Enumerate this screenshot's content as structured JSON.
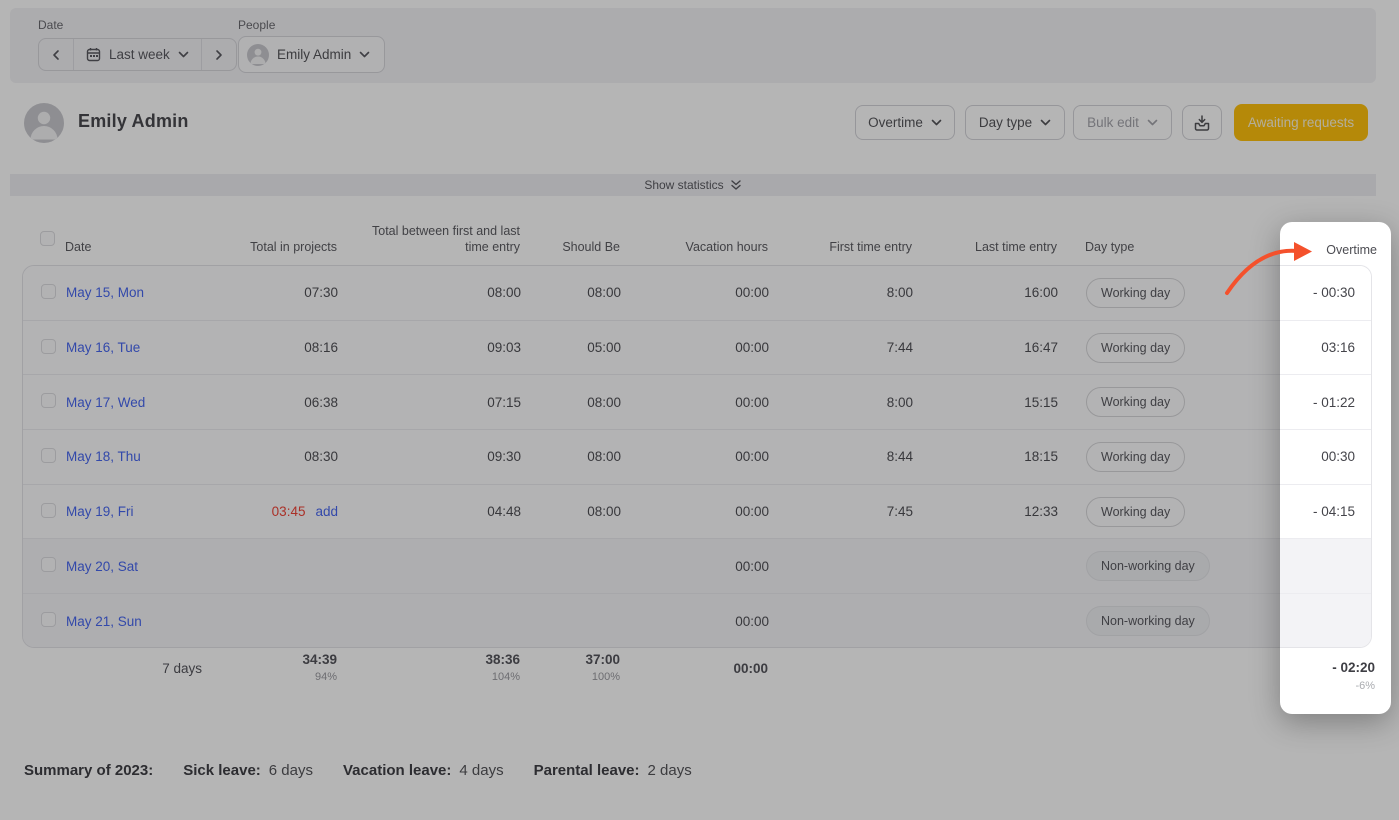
{
  "filters": {
    "date_label": "Date",
    "date_range": "Last week",
    "people_label": "People",
    "person": "Emily Admin"
  },
  "header": {
    "user_name": "Emily Admin",
    "overtime_button": "Overtime",
    "day_type_button": "Day type",
    "bulk_edit_button": "Bulk edit",
    "awaiting_button": "Awaiting requests"
  },
  "statistics_toggle": "Show statistics",
  "table": {
    "columns": [
      "Date",
      "Total in projects",
      "Total between first and last time entry",
      "Should Be",
      "Vacation hours",
      "First time entry",
      "Last time entry",
      "Day type",
      "Overtime"
    ],
    "rows": [
      {
        "date": "May 15, Mon",
        "total_projects": "07:30",
        "total_between": "08:00",
        "should_be": "08:00",
        "vacation": "00:00",
        "first": "8:00",
        "last": "16:00",
        "day_type": "Working day",
        "overtime": "- 00:30"
      },
      {
        "date": "May 16, Tue",
        "total_projects": "08:16",
        "total_between": "09:03",
        "should_be": "05:00",
        "vacation": "00:00",
        "first": "7:44",
        "last": "16:47",
        "day_type": "Working day",
        "overtime": "03:16"
      },
      {
        "date": "May 17, Wed",
        "total_projects": "06:38",
        "total_between": "07:15",
        "should_be": "08:00",
        "vacation": "00:00",
        "first": "8:00",
        "last": "15:15",
        "day_type": "Working day",
        "overtime": "- 01:22"
      },
      {
        "date": "May 18, Thu",
        "total_projects": "08:30",
        "total_between": "09:30",
        "should_be": "08:00",
        "vacation": "00:00",
        "first": "8:44",
        "last": "18:15",
        "day_type": "Working day",
        "overtime": "00:30"
      },
      {
        "date": "May 19, Fri",
        "total_projects": "03:45",
        "add_link": "add",
        "total_between": "04:48",
        "should_be": "08:00",
        "vacation": "00:00",
        "first": "7:45",
        "last": "12:33",
        "day_type": "Working day",
        "overtime": "- 04:15"
      },
      {
        "date": "May 20, Sat",
        "vacation": "00:00",
        "day_type": "Non-working day",
        "overtime": ""
      },
      {
        "date": "May 21, Sun",
        "vacation": "00:00",
        "day_type": "Non-working day",
        "overtime": ""
      }
    ],
    "summary": {
      "days": "7 days",
      "total_projects": "34:39",
      "total_projects_pct": "94%",
      "total_between": "38:36",
      "total_between_pct": "104%",
      "should_be": "37:00",
      "should_be_pct": "100%",
      "vacation": "00:00",
      "overtime_total": "- 02:20",
      "overtime_pct": "-6%"
    }
  },
  "year_summary": {
    "title": "Summary of 2023:",
    "items": [
      {
        "label": "Sick leave:",
        "value": "6 days"
      },
      {
        "label": "Vacation leave:",
        "value": "4 days"
      },
      {
        "label": "Parental leave:",
        "value": "2 days"
      }
    ]
  },
  "colors": {
    "accent_gold": "#ffc20e",
    "link_blue": "#4867f0",
    "alert_red": "#f04438",
    "arrow_orange": "#f4512c"
  }
}
